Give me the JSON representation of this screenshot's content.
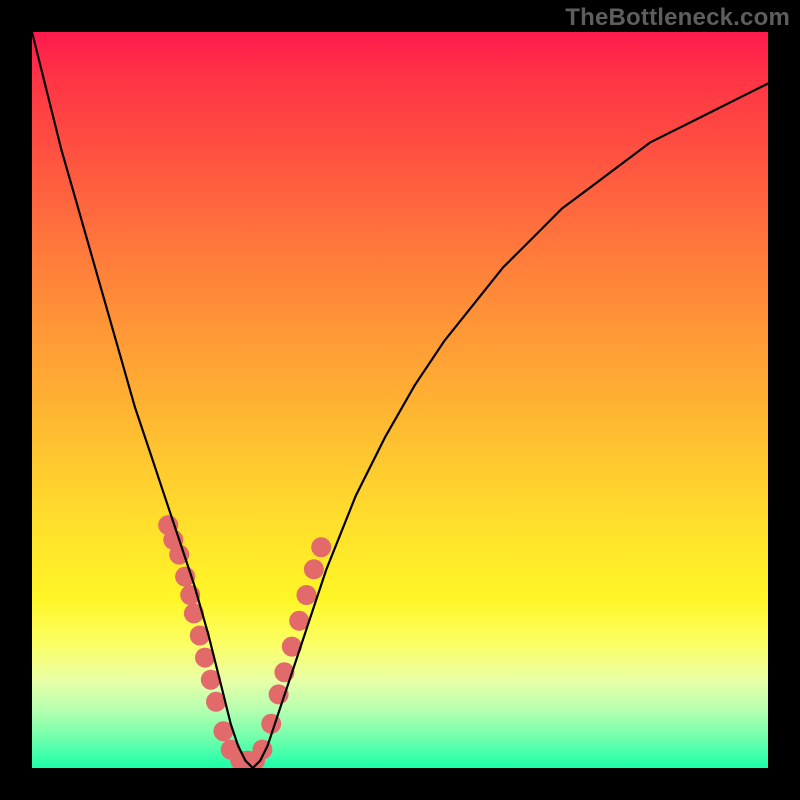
{
  "watermark": "TheBottleneck.com",
  "chart_data": {
    "type": "line",
    "title": "",
    "xlabel": "",
    "ylabel": "",
    "xlim": [
      0,
      100
    ],
    "ylim": [
      0,
      100
    ],
    "grid": false,
    "series": [
      {
        "name": "bottleneck_curve",
        "color": "#000000",
        "x": [
          0,
          2,
          4,
          6,
          8,
          10,
          12,
          14,
          16,
          18,
          20,
          22,
          24,
          25,
          26,
          27,
          28,
          29,
          30,
          31,
          32,
          33,
          34,
          36,
          38,
          40,
          44,
          48,
          52,
          56,
          60,
          64,
          68,
          72,
          76,
          80,
          84,
          88,
          92,
          96,
          100
        ],
        "y": [
          100,
          92,
          84,
          77,
          70,
          63,
          56,
          49,
          43,
          37,
          31,
          25,
          18,
          14,
          10,
          6,
          3,
          1,
          0,
          1,
          3,
          6,
          9,
          15,
          21,
          27,
          37,
          45,
          52,
          58,
          63,
          68,
          72,
          76,
          79,
          82,
          85,
          87,
          89,
          91,
          93
        ]
      }
    ],
    "overlay_points": {
      "name": "highlight_dots",
      "color": "#e26a6a",
      "radius": 10,
      "x": [
        18.5,
        19.2,
        20.0,
        20.8,
        21.5,
        22.0,
        22.8,
        23.5,
        24.3,
        25.0,
        26.0,
        27.0,
        28.3,
        29.3,
        30.3,
        31.3,
        32.5,
        33.5,
        34.3,
        35.3,
        36.3,
        37.3,
        38.3,
        39.3
      ],
      "y": [
        33.0,
        31.0,
        29.0,
        26.0,
        23.5,
        21.0,
        18.0,
        15.0,
        12.0,
        9.0,
        5.0,
        2.5,
        1.0,
        1.0,
        1.0,
        2.5,
        6.0,
        10.0,
        13.0,
        16.5,
        20.0,
        23.5,
        27.0,
        30.0
      ]
    },
    "gradient_stops": [
      {
        "offset": 0,
        "color": "#ff1a4d"
      },
      {
        "offset": 50,
        "color": "#ffbc31"
      },
      {
        "offset": 80,
        "color": "#fcff63"
      },
      {
        "offset": 100,
        "color": "#1affa8"
      }
    ]
  }
}
